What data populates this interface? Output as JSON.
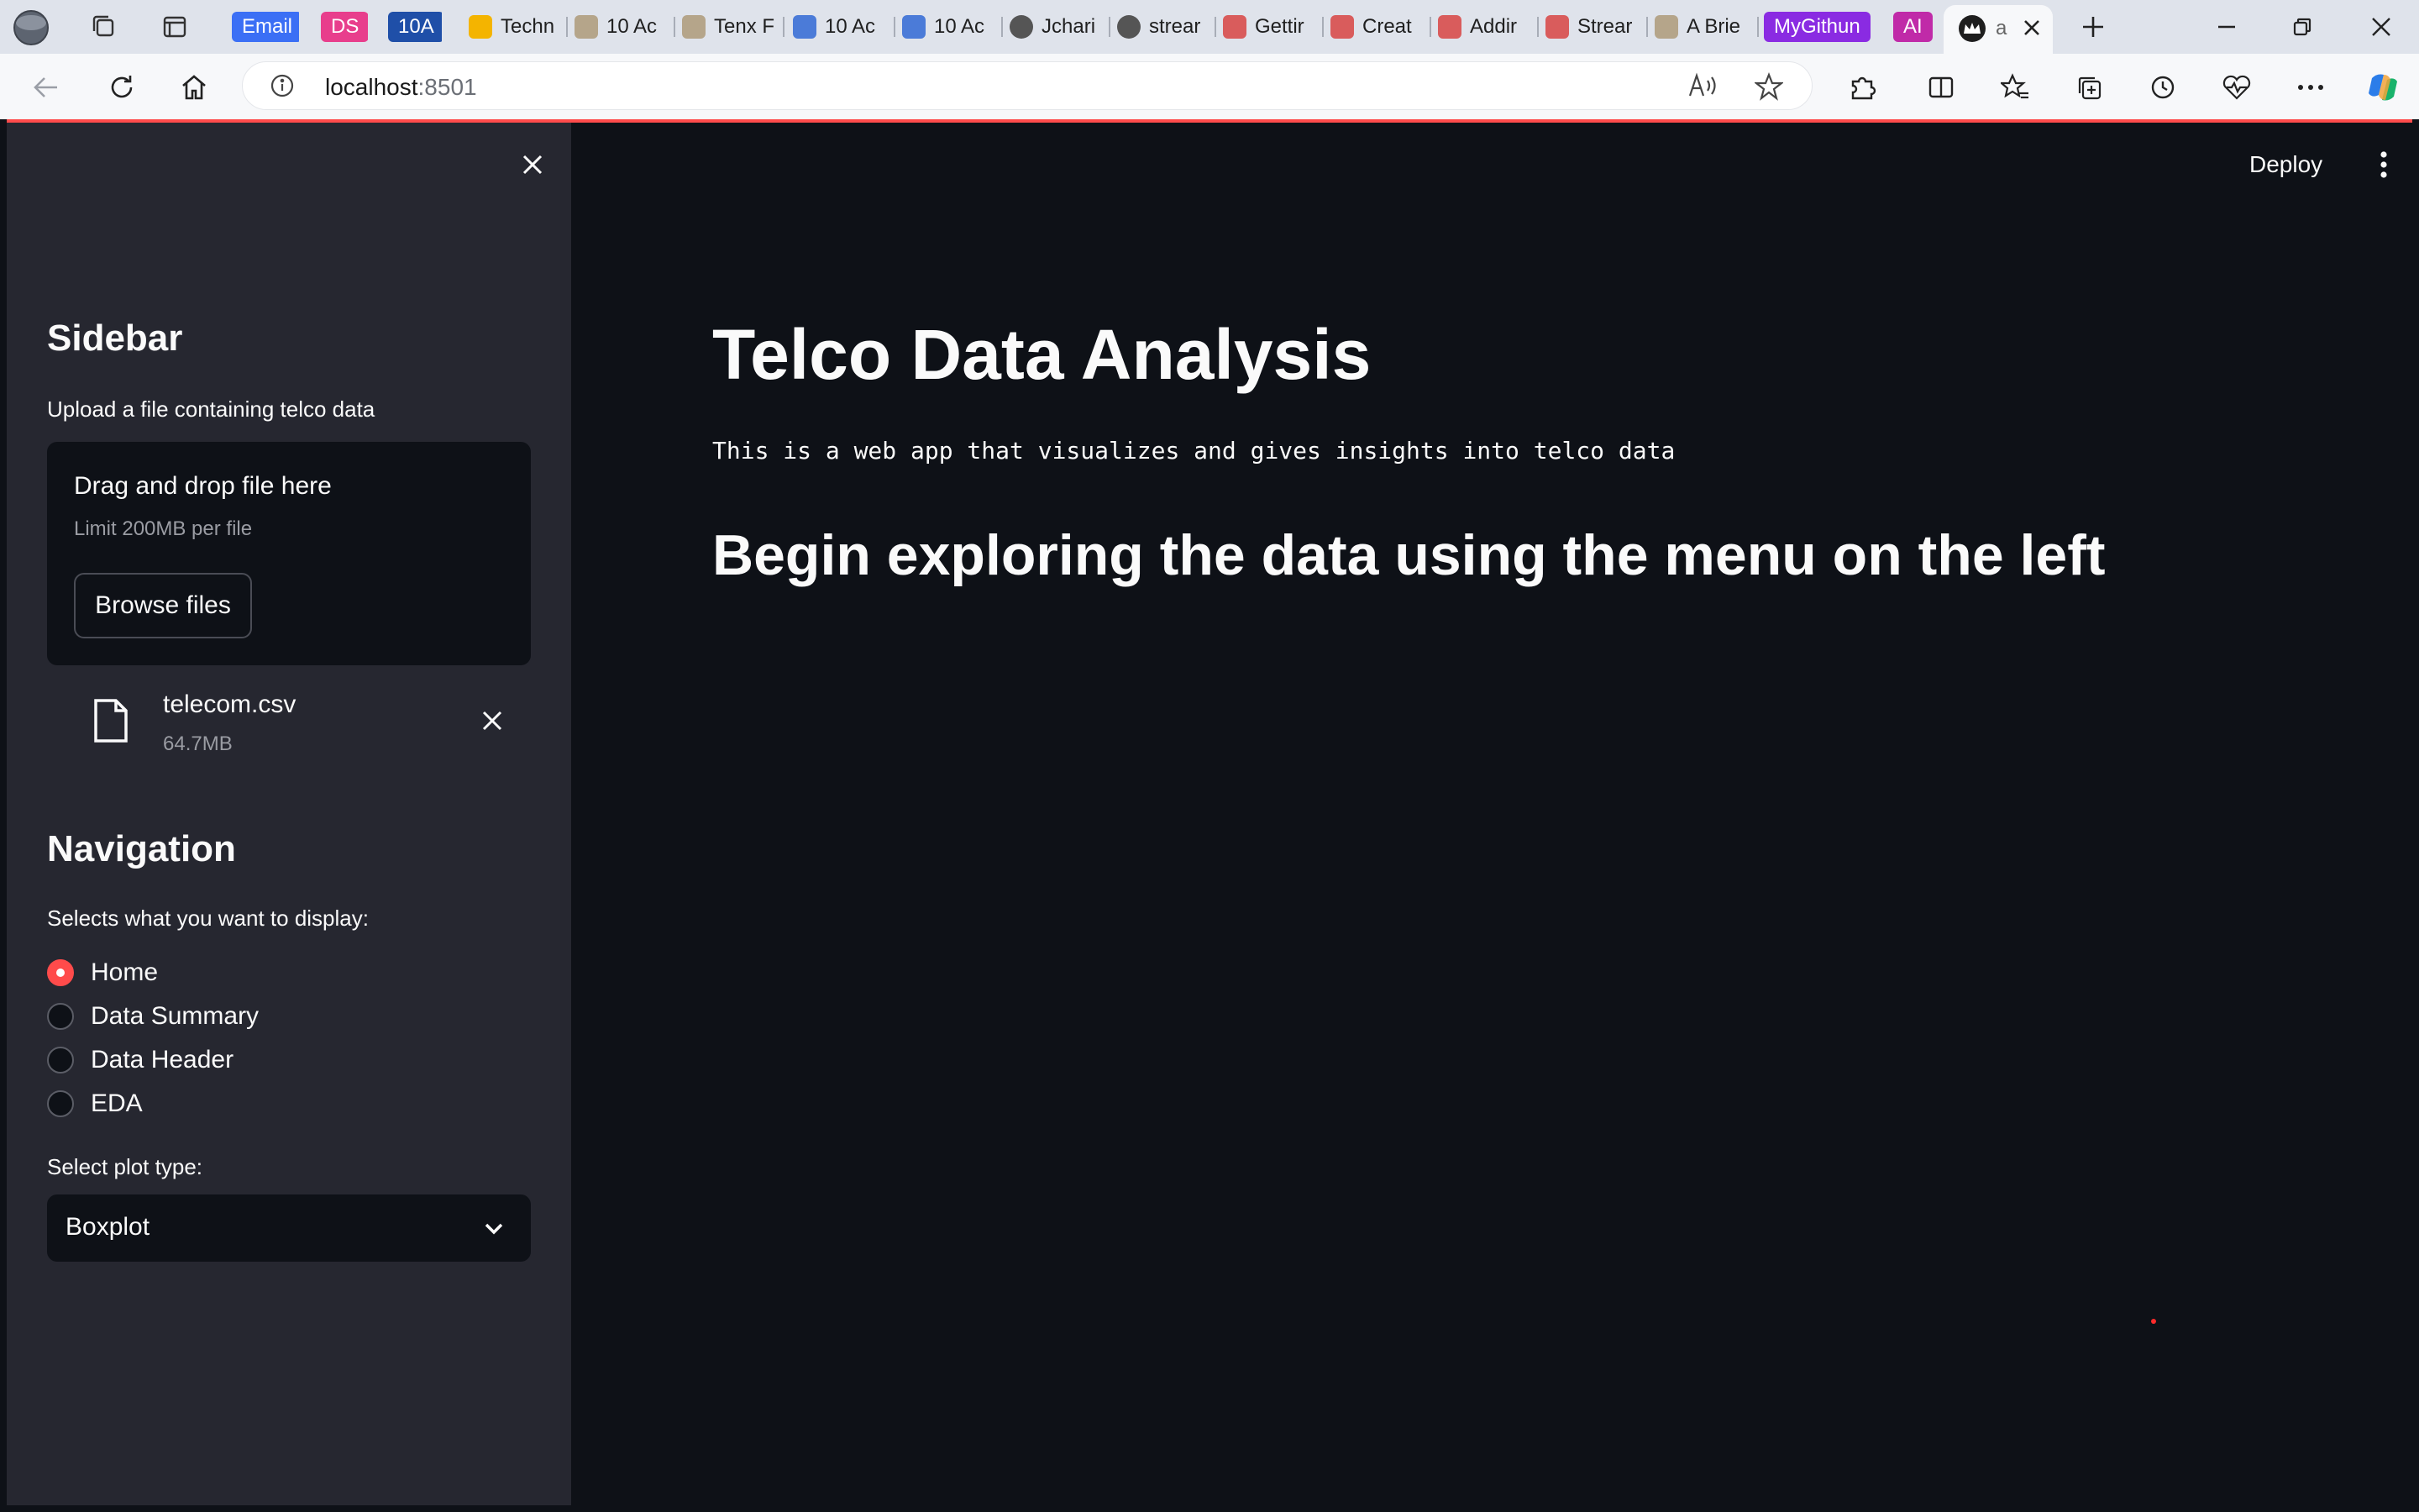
{
  "browser": {
    "tabs": [
      {
        "label": "Email",
        "color": "#3b6ff5",
        "pill": true
      },
      {
        "label": "DS",
        "color": "#e83e8c",
        "pill": true
      },
      {
        "label": "10A",
        "color": "#1f4fa8",
        "pill": true
      },
      {
        "label": "Techn",
        "icon": "drive-icon"
      },
      {
        "label": "10 Ac",
        "icon": "page-icon"
      },
      {
        "label": "Tenx F",
        "icon": "page-icon"
      },
      {
        "label": "10 Ac",
        "icon": "docs-icon"
      },
      {
        "label": "10 Ac",
        "icon": "docs-icon"
      },
      {
        "label": "Jchari",
        "icon": "github-icon"
      },
      {
        "label": "strear",
        "icon": "github-icon"
      },
      {
        "label": "Gettir",
        "icon": "youtube-icon"
      },
      {
        "label": "Creat",
        "icon": "youtube-icon"
      },
      {
        "label": "Addir",
        "icon": "youtube-icon"
      },
      {
        "label": "Strear",
        "icon": "youtube-icon"
      },
      {
        "label": "A Brie",
        "icon": "page-icon"
      },
      {
        "label": "MyGithun",
        "color": "#8a2be2",
        "pill": true
      },
      {
        "label": "AI",
        "color": "#c02aa8",
        "pill": true
      }
    ],
    "active_tab_label": "a",
    "url_host": "localhost",
    "url_port": ":8501"
  },
  "sidebar": {
    "title": "Sidebar",
    "upload_label": "Upload a file containing telco data",
    "dropzone_title": "Drag and drop file here",
    "dropzone_limit": "Limit 200MB per file",
    "browse_button": "Browse files",
    "file": {
      "name": "telecom.csv",
      "size": "64.7MB"
    },
    "nav_title": "Navigation",
    "nav_label": "Selects what you want to display:",
    "nav_options": [
      {
        "label": "Home",
        "selected": true
      },
      {
        "label": "Data Summary",
        "selected": false
      },
      {
        "label": "Data Header",
        "selected": false
      },
      {
        "label": "EDA",
        "selected": false
      }
    ],
    "plot_label": "Select plot type:",
    "plot_value": "Boxplot"
  },
  "main": {
    "title": "Telco Data Analysis",
    "description": "This is a web app that visualizes and gives insights into telco data",
    "subtitle": "Begin exploring the data using the menu on the left",
    "deploy": "Deploy"
  },
  "colors": {
    "accent": "#ff4b4b",
    "sidebar_bg": "#262730",
    "main_bg": "#0e1117",
    "text": "#fafafa"
  }
}
